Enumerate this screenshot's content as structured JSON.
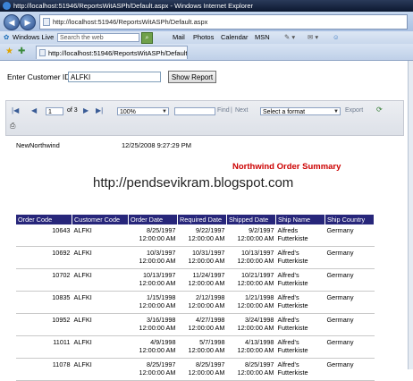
{
  "window": {
    "title": "http://localhost:51946/ReportsWitASPh/Default.aspx - Windows Internet Explorer"
  },
  "address": {
    "url": "http://localhost:51946/ReportsWitASPh/Default.aspx"
  },
  "links_bar": {
    "windows_live": "Windows Live",
    "search_placeholder": "Search the web",
    "links": [
      "Mail",
      "Photos",
      "Calendar",
      "MSN"
    ]
  },
  "tab": {
    "title": "http://localhost:51946/ReportsWitASPh/Default.a..."
  },
  "form": {
    "customer_label": "Enter Customer ID:",
    "customer_value": "ALFKI",
    "show_report_label": "Show Report"
  },
  "viewer_toolbar": {
    "page_value": "1",
    "of_pages": "of 3",
    "zoom": "100%",
    "find_label": "Find",
    "separator": "|",
    "next_label": "Next",
    "format_placeholder": "Select a format",
    "export_label": "Export"
  },
  "report": {
    "db_name": "NewNorthwind",
    "timestamp": "12/25/2008 9:27:29 PM",
    "title": "Northwind Order Summary",
    "watermark": "http://pendsevikram.blogspot.com",
    "columns": [
      "Order Code",
      "Customer Code",
      "Order Date",
      "Required Date",
      "Shipped Date",
      "Ship Name",
      "Ship Country"
    ],
    "rows": [
      {
        "code": "10643",
        "customer": "ALFKI",
        "order_date": "8/25/1997",
        "order_time": "12:00:00 AM",
        "required_date": "9/22/1997",
        "required_time": "12:00:00 AM",
        "shipped_date": "9/2/1997",
        "shipped_time": "12:00:00 AM",
        "ship_name_1": "Alfreds",
        "ship_name_2": "Futterkiste",
        "country": "Germany"
      },
      {
        "code": "10692",
        "customer": "ALFKI",
        "order_date": "10/3/1997",
        "order_time": "12:00:00 AM",
        "required_date": "10/31/1997",
        "required_time": "12:00:00 AM",
        "shipped_date": "10/13/1997",
        "shipped_time": "12:00:00 AM",
        "ship_name_1": "Alfred's",
        "ship_name_2": "Futterkiste",
        "country": "Germany"
      },
      {
        "code": "10702",
        "customer": "ALFKI",
        "order_date": "10/13/1997",
        "order_time": "12:00:00 AM",
        "required_date": "11/24/1997",
        "required_time": "12:00:00 AM",
        "shipped_date": "10/21/1997",
        "shipped_time": "12:00:00 AM",
        "ship_name_1": "Alfred's",
        "ship_name_2": "Futterkiste",
        "country": "Germany"
      },
      {
        "code": "10835",
        "customer": "ALFKI",
        "order_date": "1/15/1998",
        "order_time": "12:00:00 AM",
        "required_date": "2/12/1998",
        "required_time": "12:00:00 AM",
        "shipped_date": "1/21/1998",
        "shipped_time": "12:00:00 AM",
        "ship_name_1": "Alfred's",
        "ship_name_2": "Futterkiste",
        "country": "Germany"
      },
      {
        "code": "10952",
        "customer": "ALFKI",
        "order_date": "3/16/1998",
        "order_time": "12:00:00 AM",
        "required_date": "4/27/1998",
        "required_time": "12:00:00 AM",
        "shipped_date": "3/24/1998",
        "shipped_time": "12:00:00 AM",
        "ship_name_1": "Alfred's",
        "ship_name_2": "Futterkiste",
        "country": "Germany"
      },
      {
        "code": "11011",
        "customer": "ALFKI",
        "order_date": "4/9/1998",
        "order_time": "12:00:00 AM",
        "required_date": "5/7/1998",
        "required_time": "12:00:00 AM",
        "shipped_date": "4/13/1998",
        "shipped_time": "12:00:00 AM",
        "ship_name_1": "Alfred's",
        "ship_name_2": "Futterkiste",
        "country": "Germany"
      },
      {
        "code": "11078",
        "customer": "ALFKI",
        "order_date": "8/25/1997",
        "order_time": "12:00:00 AM",
        "required_date": "8/25/1997",
        "required_time": "12:00:00 AM",
        "shipped_date": "8/25/1997",
        "shipped_time": "12:00:00 AM",
        "ship_name_1": "Alfred's",
        "ship_name_2": "Futterkiste",
        "country": "Germany"
      }
    ]
  }
}
